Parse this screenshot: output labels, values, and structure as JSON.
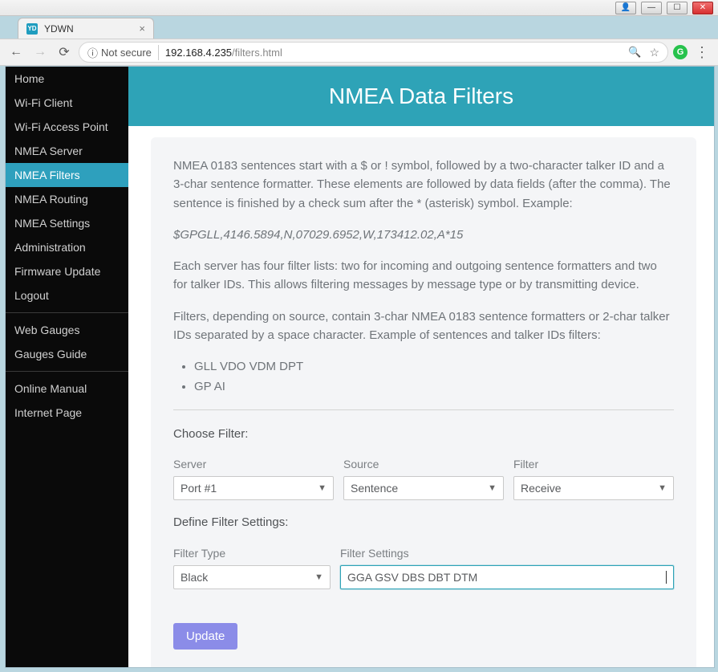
{
  "window_controls": {
    "user": "👤",
    "minimize": "—",
    "maximize": "☐",
    "close": "✕"
  },
  "browser": {
    "tab_title": "YDWN",
    "favicon_text": "YD",
    "insecure_label": "Not secure",
    "host": "192.168.4.235",
    "path": "/filters.html",
    "extension_badge": "G"
  },
  "sidebar": {
    "groups": [
      [
        "Home",
        "Wi-Fi Client",
        "Wi-Fi Access Point",
        "NMEA Server",
        "NMEA Filters",
        "NMEA Routing",
        "NMEA Settings",
        "Administration",
        "Firmware Update",
        "Logout"
      ],
      [
        "Web Gauges",
        "Gauges Guide"
      ],
      [
        "Online Manual",
        "Internet Page"
      ]
    ],
    "active": "NMEA Filters"
  },
  "page": {
    "title": "NMEA Data Filters",
    "para1": "NMEA 0183 sentences start with a $ or ! symbol, followed by a two-character talker ID and a 3-char sentence formatter. These elements are followed by data fields (after the comma). The sentence is finished by a check sum after the * (asterisk) symbol. Example:",
    "example": "$GPGLL,4146.5894,N,07029.6952,W,173412.02,A*15",
    "para2": "Each server has four filter lists: two for incoming and outgoing sentence formatters and two for talker IDs. This allows filtering messages by message type or by transmitting device.",
    "para3": "Filters, depending on source, contain 3-char NMEA 0183 sentence formatters or 2-char talker IDs separated by a space character. Example of sentences and talker IDs filters:",
    "bullets": [
      "GLL VDO VDM DPT",
      "GP AI"
    ],
    "choose_label": "Choose Filter:",
    "define_label": "Define Filter Settings:",
    "labels": {
      "server": "Server",
      "source": "Source",
      "filter": "Filter",
      "filter_type": "Filter Type",
      "filter_settings": "Filter Settings"
    },
    "values": {
      "server": "Port #1",
      "source": "Sentence",
      "filter": "Receive",
      "filter_type": "Black",
      "filter_settings": "GGA GSV DBS DBT DTM"
    },
    "update_label": "Update"
  }
}
